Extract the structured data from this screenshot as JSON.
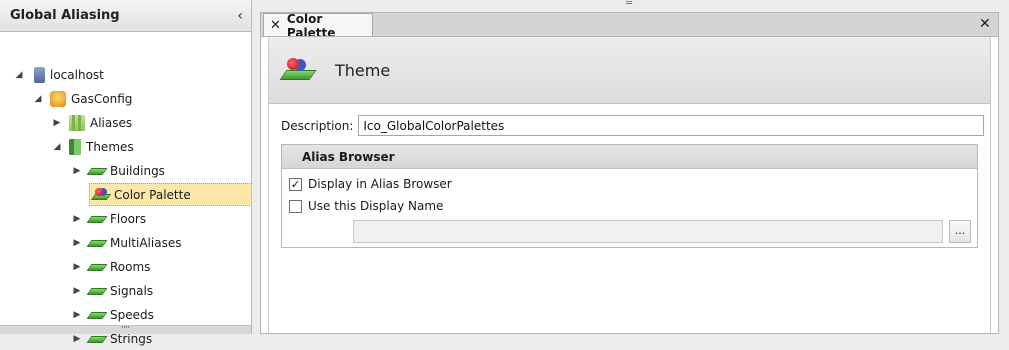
{
  "left_panel": {
    "title": "Global Aliasing",
    "collapse_glyph": "‹",
    "footer_grip": "''''",
    "tree": [
      {
        "label": "localhost",
        "icon": "server-icon",
        "expander": "◢"
      },
      {
        "label": "GasConfig",
        "icon": "database-icon",
        "expander": "◢"
      },
      {
        "label": "Aliases",
        "icon": "aliases-icon",
        "expander": "▶"
      },
      {
        "label": "Themes",
        "icon": "themes-icon",
        "expander": "◢"
      },
      {
        "label": "Buildings",
        "icon": "theme-item-icon",
        "expander": "▶"
      },
      {
        "label": "Color Palette",
        "icon": "color-palette-icon",
        "expander": "",
        "selected": true
      },
      {
        "label": "Floors",
        "icon": "theme-item-icon",
        "expander": "▶"
      },
      {
        "label": "MultiAliases",
        "icon": "theme-item-icon",
        "expander": "▶"
      },
      {
        "label": "Rooms",
        "icon": "theme-item-icon",
        "expander": "▶"
      },
      {
        "label": "Signals",
        "icon": "theme-item-icon",
        "expander": "▶"
      },
      {
        "label": "Speeds",
        "icon": "theme-item-icon",
        "expander": "▶"
      },
      {
        "label": "Strings",
        "icon": "theme-item-icon",
        "expander": "▶"
      }
    ]
  },
  "splitter_grip": "═",
  "document": {
    "tab_label": "Color Palette",
    "tab_close_glyph": "✕",
    "close_all_glyph": "✕",
    "header_title": "Theme",
    "description_label": "Description:",
    "description_value": "Ico_GlobalColorPalettes",
    "alias_browser": {
      "title": "Alias Browser",
      "display_in_browser_label": "Display in Alias Browser",
      "display_in_browser_checked": true,
      "use_display_name_label": "Use this Display Name",
      "use_display_name_checked": false,
      "display_name_value": "",
      "browse_label": "..."
    }
  }
}
